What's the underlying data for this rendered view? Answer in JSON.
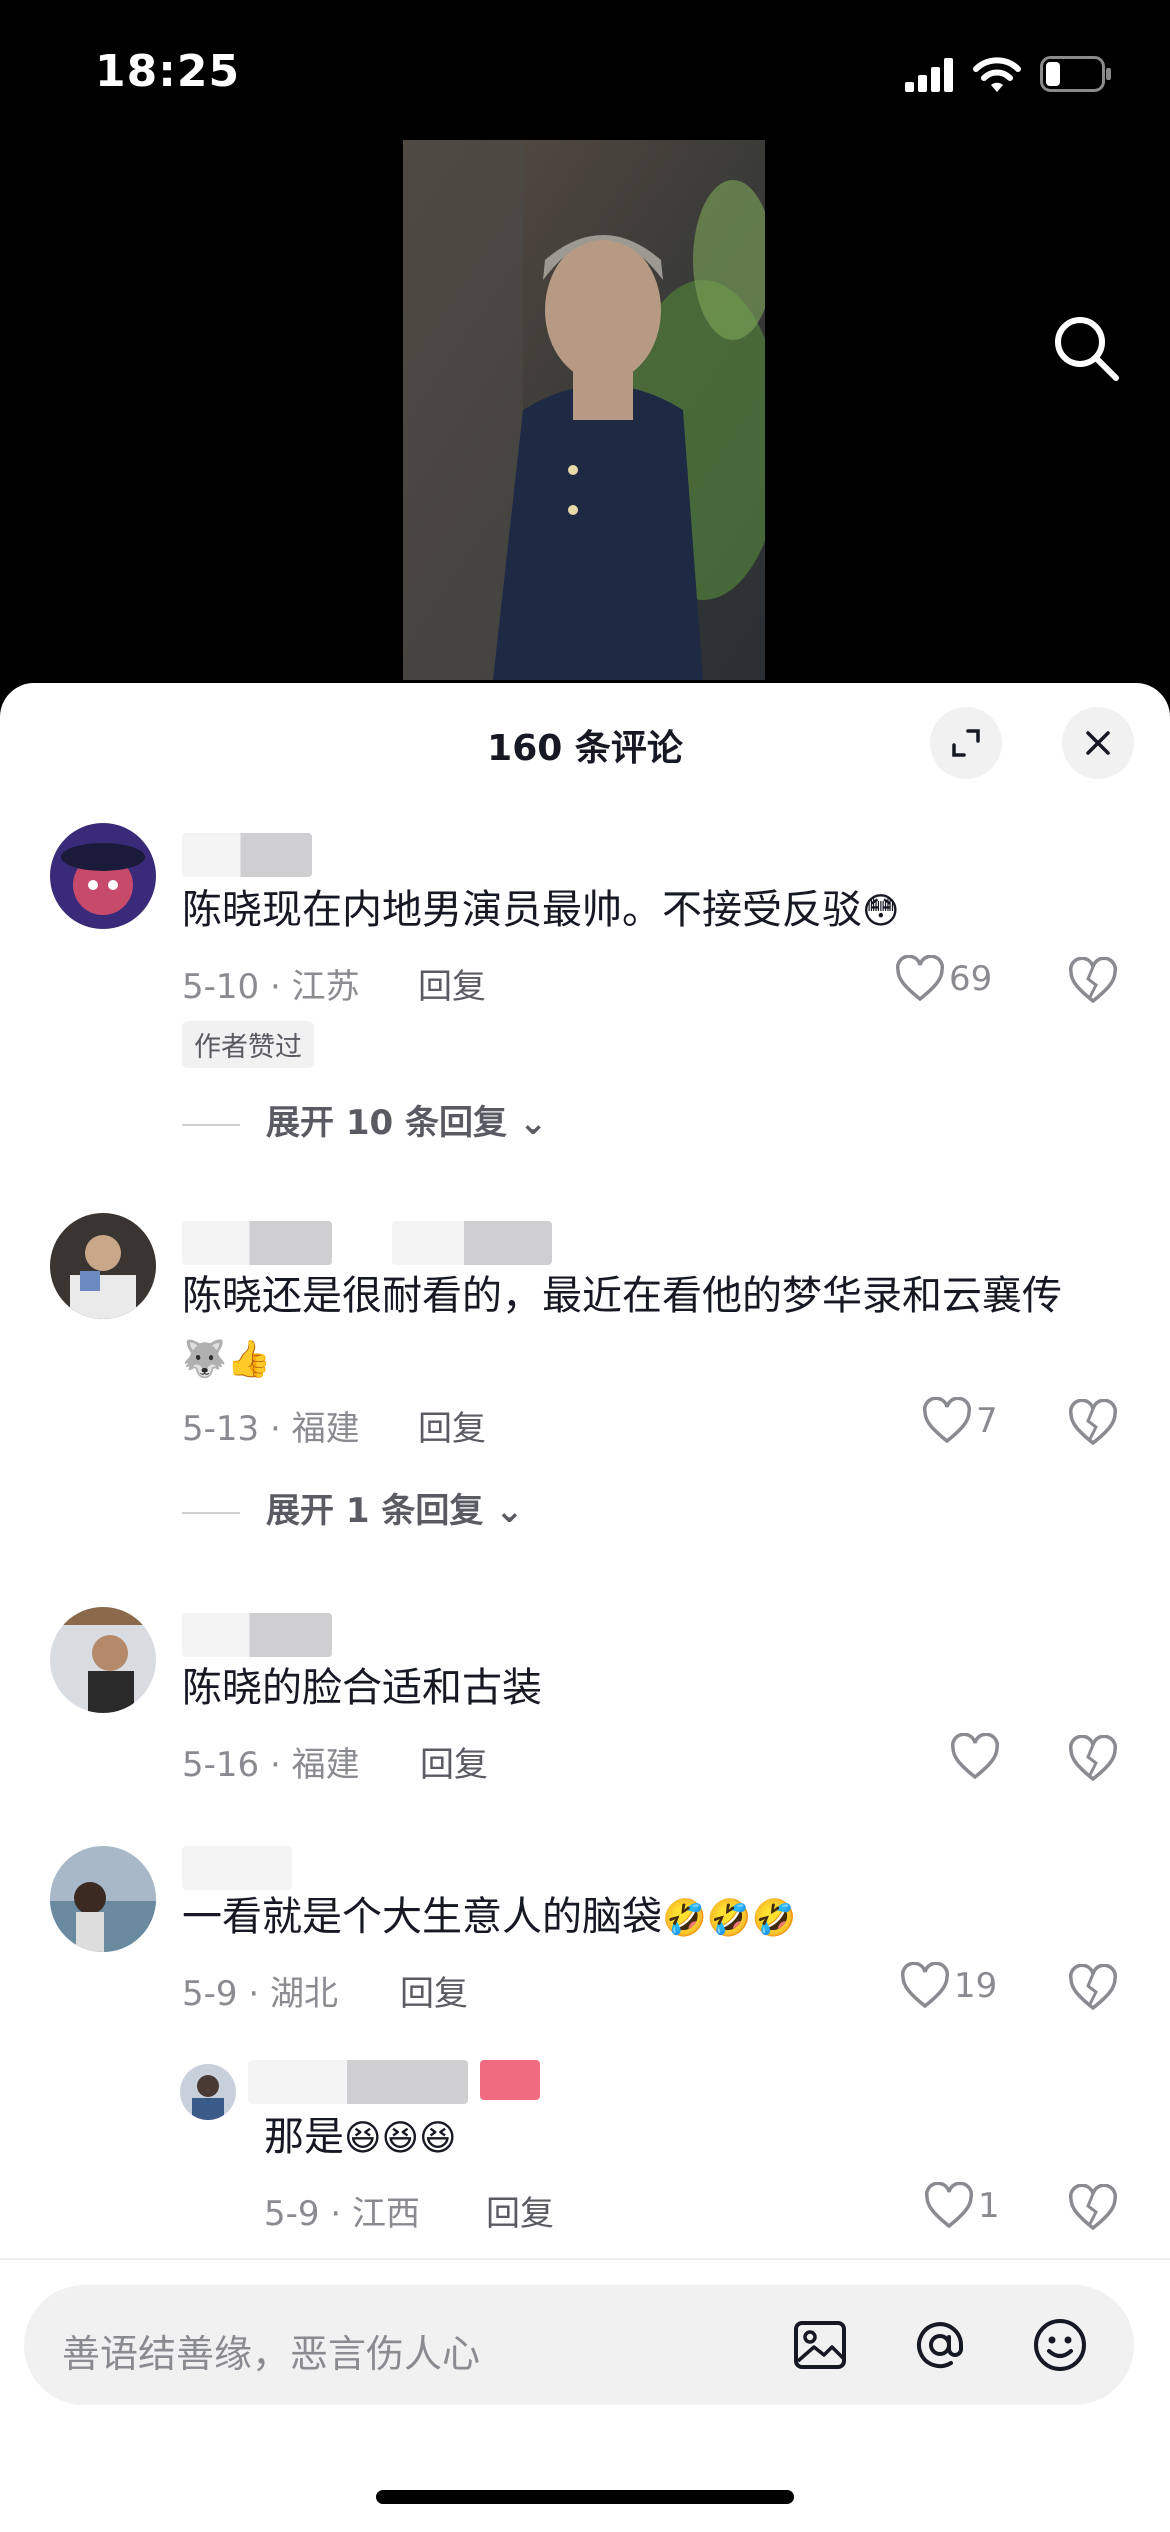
{
  "status": {
    "time": "18:25"
  },
  "sheet": {
    "title": "160 条评论"
  },
  "comments": [
    {
      "text": "陈晓现在内地男演员最帅。不接受反驳",
      "emoji": "😳",
      "date": "5-10 · 江苏",
      "reply": "回复",
      "likes": "69",
      "badge": "作者赞过",
      "expand": "展开 10 条回复"
    },
    {
      "text": "陈晓还是很耐看的，最近在看他的梦华录和云襄传",
      "emoji": "🐺👍",
      "date": "5-13 · 福建",
      "reply": "回复",
      "likes": "7",
      "expand": "展开 1 条回复"
    },
    {
      "text": "陈晓的脸合适和古装",
      "date": "5-16 · 福建",
      "reply": "回复",
      "likes": ""
    },
    {
      "text": "一看就是个大生意人的脑袋",
      "emoji": "🤣🤣🤣",
      "date": "5-9 · 湖北",
      "reply": "回复",
      "likes": "19",
      "sub_reply": {
        "text": "那是",
        "emoji": "😆😆😆",
        "date": "5-9 · 江西",
        "reply": "回复",
        "likes": "1"
      }
    }
  ],
  "input": {
    "placeholder": "善语结善缘，恶言伤人心"
  },
  "icons": {
    "search": "search-icon",
    "expand": "expand-icon",
    "close": "close-icon",
    "like": "heart-icon",
    "dislike": "broken-heart-icon",
    "image": "image-icon",
    "mention": "at-icon",
    "emoji": "emoji-icon"
  }
}
